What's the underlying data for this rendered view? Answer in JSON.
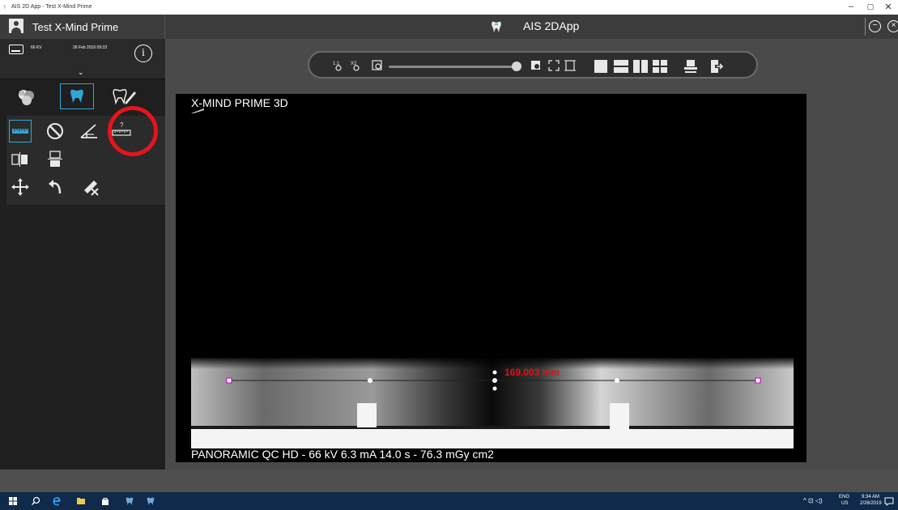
{
  "window": {
    "title": "AIS 2D App - Test X-Mind Prime",
    "controls": [
      "–",
      "▢",
      "✕"
    ]
  },
  "header": {
    "patient_name": "Test X-Mind Prime",
    "app_name": "AIS 2DApp"
  },
  "acquisition": {
    "kv": "66 KV",
    "date": "26 Feb 2019 09:33"
  },
  "modes": [
    "patient-images",
    "tooth-view",
    "dental-annotate"
  ],
  "tools": [
    "ruler-tool",
    "angle-tool",
    "protractor-tool",
    "calibrated-ruler-tool",
    "vertical-split",
    "horizontal-split",
    "pan-tool",
    "rotate-tool",
    "delete-measure-tool"
  ],
  "viewer": {
    "top_label": "X-MIND PRIME 3D",
    "bottom_label": "PANORAMIC QC HD - 66 kV 6.3 mA 14.0 s - 76.3 mGy cm2",
    "measurement": "169.003 mm"
  },
  "taskbar": {
    "lang": "ENG",
    "region": "US",
    "time": "9:34 AM",
    "date": "2/26/2019"
  },
  "colors": {
    "accent": "#2fa6d9",
    "highlight": "#e6141c",
    "measure": "#dd1111"
  }
}
